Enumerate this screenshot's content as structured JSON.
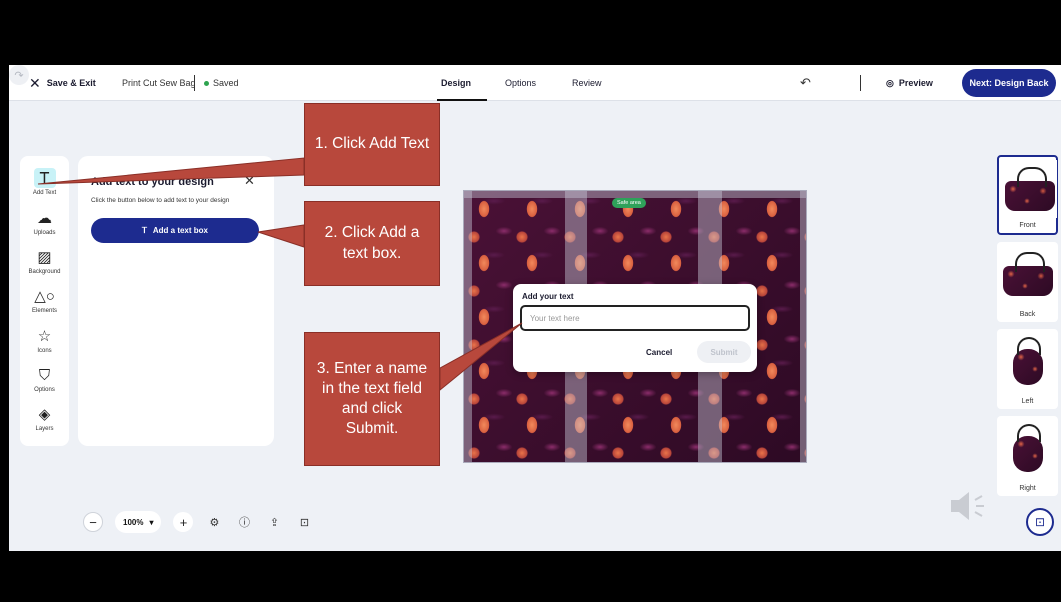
{
  "header": {
    "save_exit": "Save & Exit",
    "project_name": "Print Cut Sew Bag",
    "status": "Saved",
    "tabs": [
      "Design",
      "Options",
      "Review"
    ],
    "preview": "Preview",
    "next_button": "Next: Design Back"
  },
  "toolbar": {
    "items": [
      {
        "label": "Add Text",
        "icon": "text-icon"
      },
      {
        "label": "Uploads",
        "icon": "upload-icon"
      },
      {
        "label": "Background",
        "icon": "background-icon"
      },
      {
        "label": "Elements",
        "icon": "elements-icon"
      },
      {
        "label": "Icons",
        "icon": "star-icon"
      },
      {
        "label": "Options",
        "icon": "shirt-icon"
      },
      {
        "label": "Layers",
        "icon": "layers-icon"
      }
    ]
  },
  "panel": {
    "title": "Add text to your design",
    "subtitle": "Click the button below to add text to your design",
    "add_button": "Add a text box"
  },
  "canvas": {
    "safe_area": "Safe area"
  },
  "dialog": {
    "title": "Add your text",
    "placeholder": "Your text here",
    "cancel": "Cancel",
    "submit": "Submit"
  },
  "thumbnails": [
    "Front",
    "Back",
    "Left",
    "Right"
  ],
  "zoom": {
    "value": "100%"
  },
  "callouts": {
    "step1": "1. Click Add Text",
    "step2": "2. Click Add a text box.",
    "step3": "3. Enter a name in the text field and click Submit."
  },
  "colors": {
    "accent": "#1d2b8f",
    "callout": "#b8483c",
    "saved_dot": "#2ea44f"
  }
}
